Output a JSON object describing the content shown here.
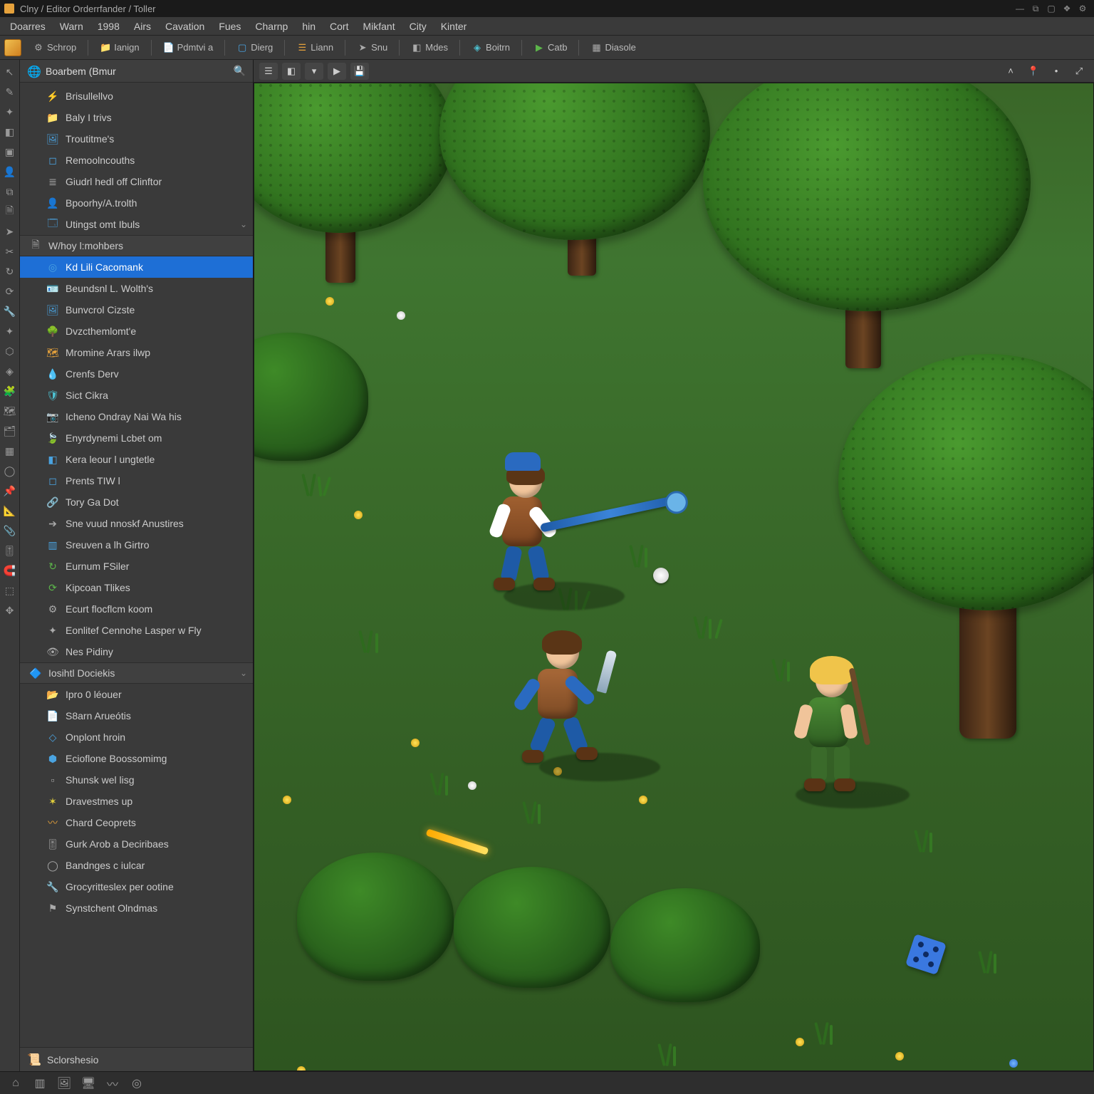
{
  "titlebar": {
    "title": "Clny / Editor  Orderrfander / Toller"
  },
  "menubar": {
    "items": [
      "Doarres",
      "Warn",
      "1998",
      "Airs",
      "Cavation",
      "Fues",
      "Charnp",
      "hin",
      "Cort",
      "Mikfant",
      "City",
      "Kinter"
    ]
  },
  "toolbar": {
    "items": [
      {
        "label": "Schrop",
        "icon": "gear-icon",
        "color": "ic-gray"
      },
      {
        "label": "Ianign",
        "icon": "folder-icon",
        "color": "ic-blue"
      },
      {
        "label": "Pdmtvi a",
        "icon": "page-icon",
        "color": "ic-gray"
      },
      {
        "label": "Dierg",
        "icon": "box-icon",
        "color": "ic-blue"
      },
      {
        "label": "Liann",
        "icon": "layers-icon",
        "color": "ic-orange"
      },
      {
        "label": "Snu",
        "icon": "arrow-icon",
        "color": "ic-gray"
      },
      {
        "label": "Mdes",
        "icon": "cube-icon",
        "color": "ic-gray"
      },
      {
        "label": "Boitrn",
        "icon": "node-icon",
        "color": "ic-cyan"
      },
      {
        "label": "Catb",
        "icon": "play-icon",
        "color": "ic-green"
      },
      {
        "label": "Diasole",
        "icon": "grid-icon",
        "color": "ic-gray"
      }
    ]
  },
  "sidebar": {
    "header": "Boarbem (Bmur",
    "footer": "Sclorshesio",
    "items": [
      {
        "label": "Brisullellvo",
        "icon": "bolt-icon",
        "color": "ic-orange",
        "type": "item"
      },
      {
        "label": "Baly I trivs",
        "icon": "folder-icon",
        "color": "ic-orange",
        "type": "item"
      },
      {
        "label": "Troutitme's",
        "icon": "image-icon",
        "color": "ic-blue",
        "type": "item"
      },
      {
        "label": "Remoolncouths",
        "icon": "square-icon",
        "color": "ic-blue",
        "type": "item"
      },
      {
        "label": "Giudrl hedl off Clinftor",
        "icon": "list-icon",
        "color": "ic-gray",
        "type": "item"
      },
      {
        "label": "Bpoorhy/A.trolth",
        "icon": "user-icon",
        "color": "ic-orange",
        "type": "item"
      },
      {
        "label": "Utingst omt Ibuls",
        "icon": "window-icon",
        "color": "ic-blue",
        "type": "item",
        "chev": true
      },
      {
        "label": "W/hoy l:mohbers",
        "icon": "document-icon",
        "color": "ic-gray",
        "type": "section"
      },
      {
        "label": "Kd Lili Cacomank",
        "icon": "target-icon",
        "color": "ic-blue",
        "type": "item",
        "selected": true
      },
      {
        "label": "Beundsnl L. Wolth's",
        "icon": "id-icon",
        "color": "ic-orange",
        "type": "item"
      },
      {
        "label": "Bunvcrol Cizste",
        "icon": "image-icon",
        "color": "ic-blue",
        "type": "item"
      },
      {
        "label": "Dvzcthemlomt'e",
        "icon": "tree-icon",
        "color": "ic-green",
        "type": "item"
      },
      {
        "label": "Mromine Arars ilwp",
        "icon": "map-icon",
        "color": "ic-orange",
        "type": "item"
      },
      {
        "label": "Crenfs Derv",
        "icon": "droplet-icon",
        "color": "ic-blue",
        "type": "item"
      },
      {
        "label": "Sict Cikra",
        "icon": "shield-icon",
        "color": "ic-cyan",
        "type": "item"
      },
      {
        "label": "Icheno Ondray Nai Wa his",
        "icon": "camera-icon",
        "color": "ic-gray",
        "type": "item"
      },
      {
        "label": "Enyrdynemi Lcbet om",
        "icon": "leaf-icon",
        "color": "ic-green",
        "type": "item"
      },
      {
        "label": "Kera leour l ungtetle",
        "icon": "cube-icon",
        "color": "ic-blue",
        "type": "item"
      },
      {
        "label": "Prents TIW l",
        "icon": "square-icon",
        "color": "ic-blue",
        "type": "item"
      },
      {
        "label": "Tory Ga Dot",
        "icon": "link-icon",
        "color": "ic-gray",
        "type": "item"
      },
      {
        "label": "Sne vuud nnoskf Anustires",
        "icon": "arrow-right-icon",
        "color": "ic-gray",
        "type": "item"
      },
      {
        "label": "Sreuven a lh Girtro",
        "icon": "panel-icon",
        "color": "ic-blue",
        "type": "item"
      },
      {
        "label": "Eurnum FSiler",
        "icon": "refresh-icon",
        "color": "ic-green",
        "type": "item"
      },
      {
        "label": "Kipcoan Tlikes",
        "icon": "sync-icon",
        "color": "ic-green",
        "type": "item"
      },
      {
        "label": "Ecurt flocflcm koom",
        "icon": "gear-icon",
        "color": "ic-gray",
        "type": "item"
      },
      {
        "label": "Eonlitef Cennohe Lasper w Fly",
        "icon": "sparkle-icon",
        "color": "ic-gray",
        "type": "item"
      },
      {
        "label": "Nes Pidiny",
        "icon": "eye-icon",
        "color": "ic-gray",
        "type": "item"
      },
      {
        "label": "Iosihtl Dociekis",
        "icon": "app-icon",
        "color": "ic-blue",
        "type": "section",
        "chev": true
      },
      {
        "label": "Ipro 0 léouer",
        "icon": "open-icon",
        "color": "ic-orange",
        "type": "item"
      },
      {
        "label": "S8arn Arueótis",
        "icon": "page-icon",
        "color": "ic-gray",
        "type": "item"
      },
      {
        "label": "Onplont hroin",
        "icon": "diamond-icon",
        "color": "ic-blue",
        "type": "item"
      },
      {
        "label": "Ecioflone Boossomimg",
        "icon": "hex-icon",
        "color": "ic-blue",
        "type": "item"
      },
      {
        "label": "Shunsk wel lisg",
        "icon": "square2-icon",
        "color": "ic-gray",
        "type": "item"
      },
      {
        "label": "Dravestmes up",
        "icon": "star-icon",
        "color": "ic-yellow",
        "type": "item"
      },
      {
        "label": "Chard Ceoprets",
        "icon": "wave-icon",
        "color": "ic-orange",
        "type": "item"
      },
      {
        "label": "Gurk Arob a Deciribaes",
        "icon": "sliders-icon",
        "color": "ic-gray",
        "type": "item"
      },
      {
        "label": "Bandnges c iulcar",
        "icon": "circle-icon",
        "color": "ic-gray",
        "type": "item"
      },
      {
        "label": "Grocyritteslex per ootine",
        "icon": "wrench-icon",
        "color": "ic-orange",
        "type": "item"
      },
      {
        "label": "Synstchent Olndmas",
        "icon": "flag-icon",
        "color": "ic-gray",
        "type": "item"
      }
    ]
  },
  "viewportToolbar": {
    "left": [
      "layers-icon",
      "cube-icon",
      "chevron-down-icon",
      "play-icon",
      "save-icon"
    ],
    "right": [
      "caret-up-icon",
      "pin-icon",
      "dot-icon",
      "expand-icon"
    ]
  },
  "statusbar": {
    "left": [
      "home-icon",
      "panel-icon",
      "image-icon",
      "monitor-icon",
      "wave-icon",
      "target-icon"
    ]
  },
  "iconGlyphs": {
    "gear-icon": "⚙",
    "folder-icon": "📁",
    "page-icon": "📄",
    "box-icon": "▢",
    "layers-icon": "☰",
    "arrow-icon": "➤",
    "cube-icon": "◧",
    "node-icon": "◈",
    "play-icon": "▶",
    "grid-icon": "▦",
    "bolt-icon": "⚡",
    "image-icon": "🖼",
    "square-icon": "◻",
    "list-icon": "≣",
    "user-icon": "👤",
    "window-icon": "🗔",
    "document-icon": "🗎",
    "target-icon": "◎",
    "id-icon": "🪪",
    "tree-icon": "🌳",
    "map-icon": "🗺",
    "droplet-icon": "💧",
    "shield-icon": "🛡",
    "camera-icon": "📷",
    "leaf-icon": "🍃",
    "link-icon": "🔗",
    "arrow-right-icon": "➔",
    "panel-icon": "▥",
    "refresh-icon": "↻",
    "sync-icon": "⟳",
    "sparkle-icon": "✦",
    "eye-icon": "👁",
    "app-icon": "🔷",
    "open-icon": "📂",
    "diamond-icon": "◇",
    "hex-icon": "⬢",
    "square2-icon": "▫",
    "star-icon": "✶",
    "wave-icon": "〰",
    "sliders-icon": "🎚",
    "circle-icon": "◯",
    "wrench-icon": "🔧",
    "flag-icon": "⚑",
    "save-icon": "💾",
    "chevron-down-icon": "▾",
    "caret-up-icon": "˄",
    "pin-icon": "📍",
    "dot-icon": "•",
    "expand-icon": "⤢",
    "home-icon": "⌂",
    "monitor-icon": "🖥"
  }
}
